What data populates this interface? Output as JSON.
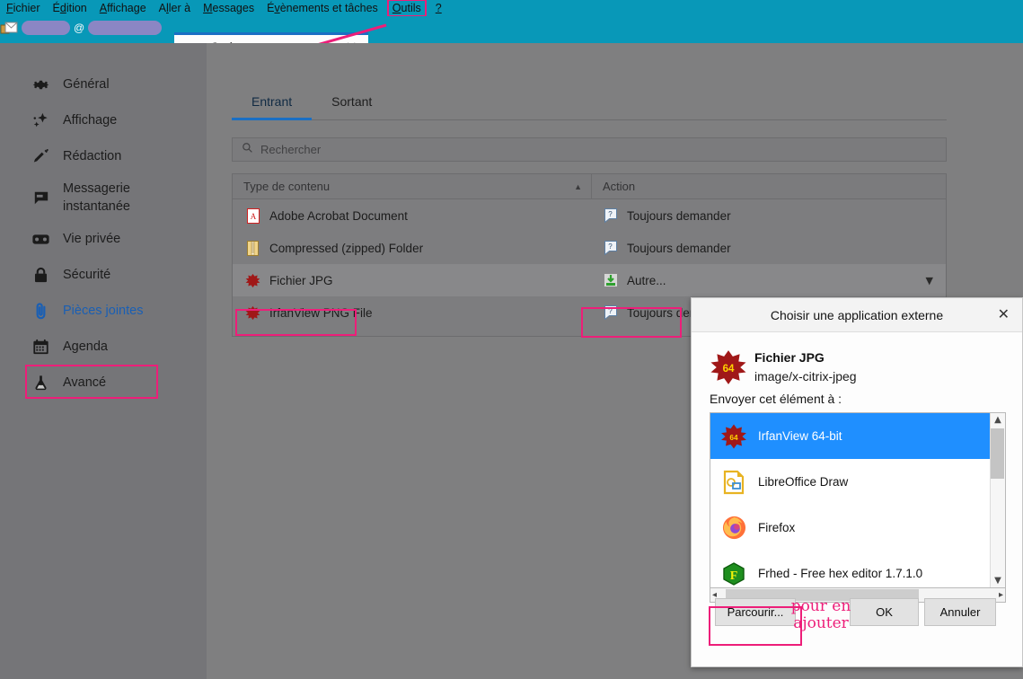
{
  "menubar": {
    "items": [
      {
        "label": "Fichier",
        "accel": "F"
      },
      {
        "label": "Édition",
        "accel": "d"
      },
      {
        "label": "Affichage",
        "accel": "A"
      },
      {
        "label": "Aller à",
        "accel": "l"
      },
      {
        "label": "Messages",
        "accel": "M"
      },
      {
        "label": "Évènements et tâches",
        "accel": "v"
      },
      {
        "label": "Outils",
        "accel": "O"
      },
      {
        "label": "?",
        "accel": ""
      }
    ],
    "highlighted_item": "Outils",
    "highlight_color": "#ed1e79",
    "background": "#0898b8"
  },
  "tabstrip": {
    "account_at": "@",
    "account_redacted": true,
    "mail_icon": "mail-icon",
    "tab": {
      "icon": "gear-icon",
      "label": "Options",
      "close_icon": "close-icon",
      "accent": "#1b6fc4"
    }
  },
  "sidebar": {
    "background": "#757578",
    "items": [
      {
        "label": "Général",
        "icon": "gear-icon",
        "active": false
      },
      {
        "label": "Affichage",
        "icon": "sparkle-icon",
        "active": false
      },
      {
        "label": "Rédaction",
        "icon": "pencil-icon",
        "active": false
      },
      {
        "label": "Messagerie instantanée",
        "icon": "chat-bubble-icon",
        "active": false
      },
      {
        "label": "Vie privée",
        "icon": "mask-icon",
        "active": false
      },
      {
        "label": "Sécurité",
        "icon": "lock-icon",
        "active": false
      },
      {
        "label": "Pièces jointes",
        "icon": "paperclip-icon",
        "active": true
      },
      {
        "label": "Agenda",
        "icon": "calendar-icon",
        "active": false
      },
      {
        "label": "Avancé",
        "icon": "flask-icon",
        "active": false
      }
    ],
    "selection_highlight_color": "#ed1e79"
  },
  "main": {
    "tabs": [
      {
        "label": "Entrant",
        "selected": true
      },
      {
        "label": "Sortant",
        "selected": false
      }
    ],
    "search": {
      "placeholder": "Rechercher",
      "value": "",
      "icon": "search-icon"
    },
    "table": {
      "columns": [
        {
          "label": "Type de contenu",
          "sort": "asc",
          "sort_icon": "caret-up-icon"
        },
        {
          "label": "Action"
        }
      ],
      "rows": [
        {
          "type": "Adobe Acrobat Document",
          "type_icon": "pdf-file-icon",
          "action": "Toujours demander",
          "action_icon": "ask-icon",
          "selected": false
        },
        {
          "type": "Compressed (zipped) Folder",
          "type_icon": "zip-file-icon",
          "action": "Toujours demander",
          "action_icon": "ask-icon",
          "selected": false
        },
        {
          "type": "Fichier JPG",
          "type_icon": "irfanview-icon",
          "action": "Autre...",
          "action_icon": "save-other-icon",
          "selected": true,
          "chevron": "chevron-down-icon"
        },
        {
          "type": "IrfanView PNG File",
          "type_icon": "irfanview-icon",
          "action": "Toujours demander",
          "action_icon": "ask-icon",
          "selected": false
        }
      ]
    },
    "highlight_color": "#ed1e79"
  },
  "dialog": {
    "title": "Choisir une application externe",
    "close_icon": "close-icon",
    "file": {
      "name": "Fichier JPG",
      "mime": "image/x-citrix-jpeg",
      "icon": "irfanview-icon"
    },
    "send_to_label": "Envoyer cet élément à :",
    "apps": [
      {
        "label": "IrfanView 64-bit",
        "icon": "irfanview-icon",
        "selected": true
      },
      {
        "label": "LibreOffice Draw",
        "icon": "libreoffice-draw-icon",
        "selected": false
      },
      {
        "label": "Firefox",
        "icon": "firefox-icon",
        "selected": false
      },
      {
        "label": "Frhed - Free hex editor 1.7.1.0",
        "icon": "frhed-icon",
        "selected": false
      }
    ],
    "scrollbars": {
      "vertical": {
        "up_icon": "caret-up-icon",
        "down_icon": "caret-down-icon"
      },
      "horizontal": {
        "left_icon": "caret-left-icon",
        "right_icon": "caret-right-icon"
      }
    },
    "buttons": [
      {
        "label": "Parcourir...",
        "highlighted": true
      },
      {
        "label": "OK",
        "highlighted": false
      },
      {
        "label": "Annuler",
        "highlighted": false
      }
    ],
    "selection_color": "#1f8fff",
    "highlight_color": "#ed1e79"
  },
  "annotations": {
    "browse_note": "pour en ajouter",
    "color": "#ed1e79"
  }
}
